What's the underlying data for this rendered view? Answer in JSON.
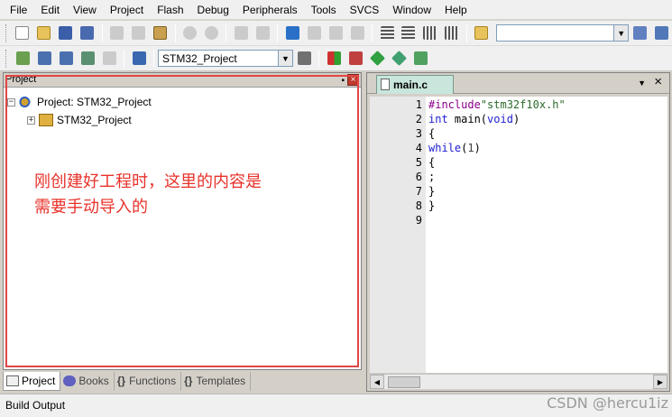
{
  "menu": [
    "File",
    "Edit",
    "View",
    "Project",
    "Flash",
    "Debug",
    "Peripherals",
    "Tools",
    "SVCS",
    "Window",
    "Help"
  ],
  "toolbar": {
    "target_combo": "STM32_Project",
    "find_combo": ""
  },
  "project_panel": {
    "title": "Project",
    "pin_glyph": "▪",
    "close_glyph": "×",
    "tree": {
      "root_label": "Project: STM32_Project",
      "child_label": "STM32_Project",
      "root_expander": "−",
      "child_expander": "+"
    },
    "annotation_line1": "刚创建好工程时，这里的内容是",
    "annotation_line2": "需要手动导入的"
  },
  "bottom_tabs": [
    {
      "label": "Project",
      "icon": "project-icon"
    },
    {
      "label": "Books",
      "icon": "books-icon"
    },
    {
      "label": "Functions",
      "icon": "functions-icon"
    },
    {
      "label": "Templates",
      "icon": "templates-icon"
    }
  ],
  "bottom_tab_glyphs": {
    "functions": "{}",
    "templates": "{}"
  },
  "editor": {
    "tab_label": "main.c",
    "tab_menu_glyph": "▼",
    "tab_close_glyph": "×",
    "line_numbers": [
      "1",
      "2",
      "3",
      "4",
      "5",
      "6",
      "7",
      "8",
      "9"
    ],
    "lines": [
      "#include\"stm32f10x.h\"",
      "int main(void)",
      "{",
      "while(1)",
      "{",
      ";",
      "}",
      "}",
      ""
    ]
  },
  "status": {
    "build_output": "Build Output",
    "watermark": "CSDN @hercu1iz"
  },
  "colors": {
    "annotation": "#e8322a",
    "highlight_box": "#e04545",
    "editor_tab": "#c8e6dc"
  }
}
